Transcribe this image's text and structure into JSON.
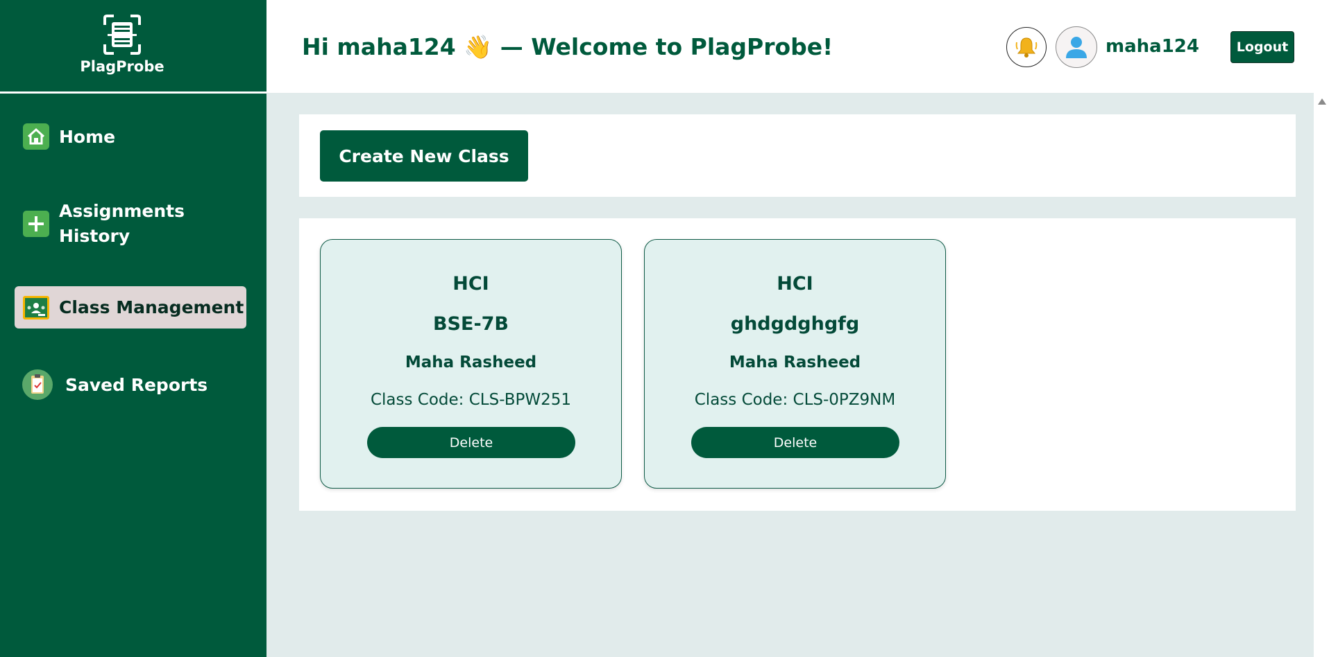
{
  "app": {
    "logo_text": "PlagProbe",
    "brand_color": "#005a3c",
    "accent_bg": "#e1ebeb"
  },
  "sidebar": {
    "items": [
      {
        "label": "Home",
        "icon": "home-icon",
        "active": false
      },
      {
        "label": "Assignments History",
        "icon": "plus-icon",
        "active": false
      },
      {
        "label": "Class Management",
        "icon": "classroom-icon",
        "active": true
      },
      {
        "label": "Saved Reports",
        "icon": "clipboard-icon",
        "active": false
      }
    ]
  },
  "header": {
    "welcome_prefix": "Hi maha124 ",
    "wave_emoji": "👋",
    "welcome_suffix": " — Welcome to PlagProbe!",
    "username": "maha124",
    "logout_label": "Logout",
    "bell_icon": "bell-icon",
    "avatar_icon": "user-avatar-icon"
  },
  "main": {
    "create_button_label": "Create New Class",
    "classes": [
      {
        "title": "HCI",
        "section": "BSE-7B",
        "teacher": "Maha Rasheed",
        "code": "Class Code: CLS-BPW251",
        "delete_label": "Delete"
      },
      {
        "title": "HCI",
        "section": "ghdgdghgfg",
        "teacher": "Maha Rasheed",
        "code": "Class Code: CLS-0PZ9NM",
        "delete_label": "Delete"
      }
    ]
  }
}
